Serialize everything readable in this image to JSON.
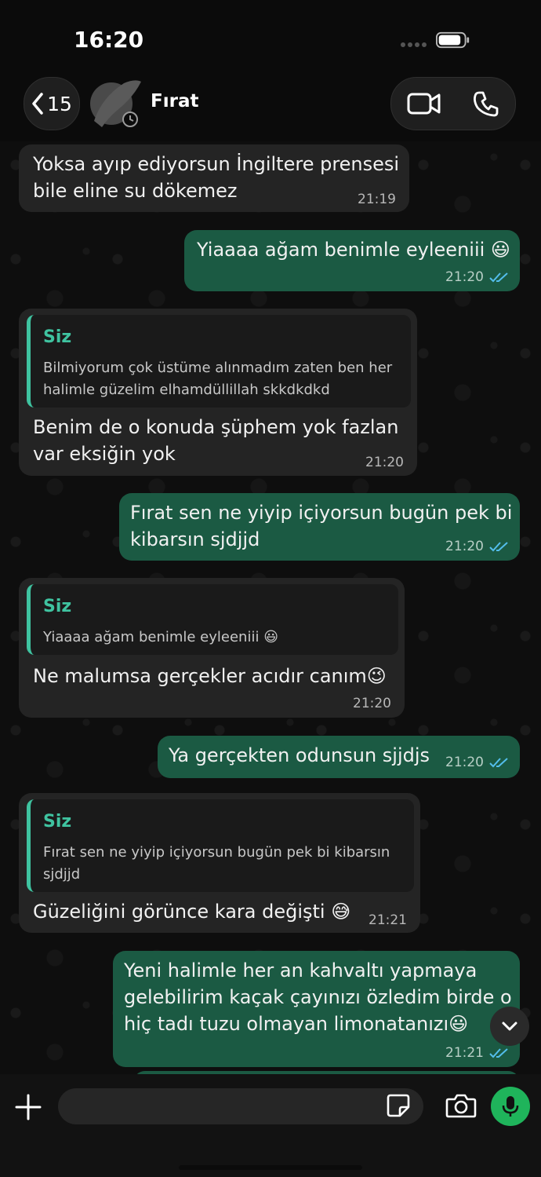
{
  "status": {
    "time": "16:20"
  },
  "header": {
    "back_count": "15",
    "contact_name": "Fırat"
  },
  "messages": [
    {
      "direction": "in",
      "text_lines": [
        "Yoksa ayıp ediyorsun İngiltere prensesi",
        "bile eline su dökemez"
      ],
      "time": "21:19"
    },
    {
      "direction": "out",
      "text_lines": [
        "Yiaaaa ağam benimle eyleeniii 😃"
      ],
      "time": "21:20"
    },
    {
      "direction": "in",
      "quote_author": "Siz",
      "quote_lines": [
        "Bilmiyorum çok üstüme alınmadım zaten ben her",
        "halimle güzelim elhamdüllillah skkdkdkd"
      ],
      "text_lines": [
        "Benim de o konuda şüphem yok fazlan",
        "var eksiğin yok"
      ],
      "time": "21:20"
    },
    {
      "direction": "out",
      "text_lines": [
        "Fırat sen ne yiyip içiyorsun bugün pek bi",
        "kibarsın sjdjjd"
      ],
      "time": "21:20"
    },
    {
      "direction": "in",
      "quote_author": "Siz",
      "quote_lines": [
        "Yiaaaa ağam benimle eyleeniii 😃"
      ],
      "text_lines": [
        "Ne malumsa  gerçekler acıdır canım😉"
      ],
      "time": "21:20"
    },
    {
      "direction": "out",
      "text_lines": [
        "Ya gerçekten odunsun sjjdjs"
      ],
      "time": "21:20"
    },
    {
      "direction": "in",
      "quote_author": "Siz",
      "quote_lines": [
        "Fırat sen ne yiyip içiyorsun bugün pek bi kibarsın",
        "sjdjjd"
      ],
      "text_lines": [
        "Güzeliğini görünce kara değişti 😅"
      ],
      "time": "21:21"
    },
    {
      "direction": "out",
      "text_lines": [
        "Yeni halimle her an kahvaltı yapmaya",
        "gelebilirim kaçak çayınızı özledim birde o",
        "hiç tadı tuzu olmayan limonatanızı😃"
      ],
      "time": "21:21"
    }
  ],
  "composer": {
    "placeholder": ""
  },
  "colors": {
    "outgoing": "#1b5a43",
    "incoming": "#242424",
    "accent": "#3fc3a0",
    "mic": "#1fb45b",
    "read_ticks": "#53bdeb"
  },
  "icons": [
    "back-chevron-icon",
    "video-camera-icon",
    "phone-icon",
    "plus-icon",
    "sticker-icon",
    "camera-icon",
    "microphone-icon",
    "chevron-down-icon",
    "read-ticks-icon"
  ]
}
